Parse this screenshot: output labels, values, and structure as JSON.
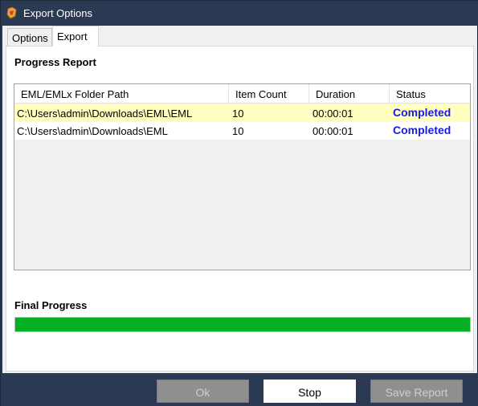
{
  "window": {
    "title": "Export Options"
  },
  "tabs": [
    {
      "label": "Options",
      "selected": false
    },
    {
      "label": "Export",
      "selected": true
    }
  ],
  "progress_report": {
    "heading": "Progress Report",
    "columns": [
      "EML/EMLx Folder Path",
      "Item Count",
      "Duration",
      "Status"
    ],
    "rows": [
      {
        "path": "C:\\Users\\admin\\Downloads\\EML\\EML",
        "count": "10",
        "duration": "00:00:01",
        "status": "Completed",
        "highlighted": true
      },
      {
        "path": "C:\\Users\\admin\\Downloads\\EML",
        "count": "10",
        "duration": "00:00:01",
        "status": "Completed",
        "highlighted": false
      }
    ]
  },
  "final_progress": {
    "heading": "Final Progress",
    "value": 1.0,
    "color": "#06b025"
  },
  "buttons": {
    "ok": "Ok",
    "stop": "Stop",
    "save_report": "Save Report"
  },
  "colors": {
    "frame": "#2b3a52",
    "status_text": "#1a1adf",
    "highlight_row": "#ffffc0"
  },
  "icons": {
    "app": "app-logo-icon"
  }
}
